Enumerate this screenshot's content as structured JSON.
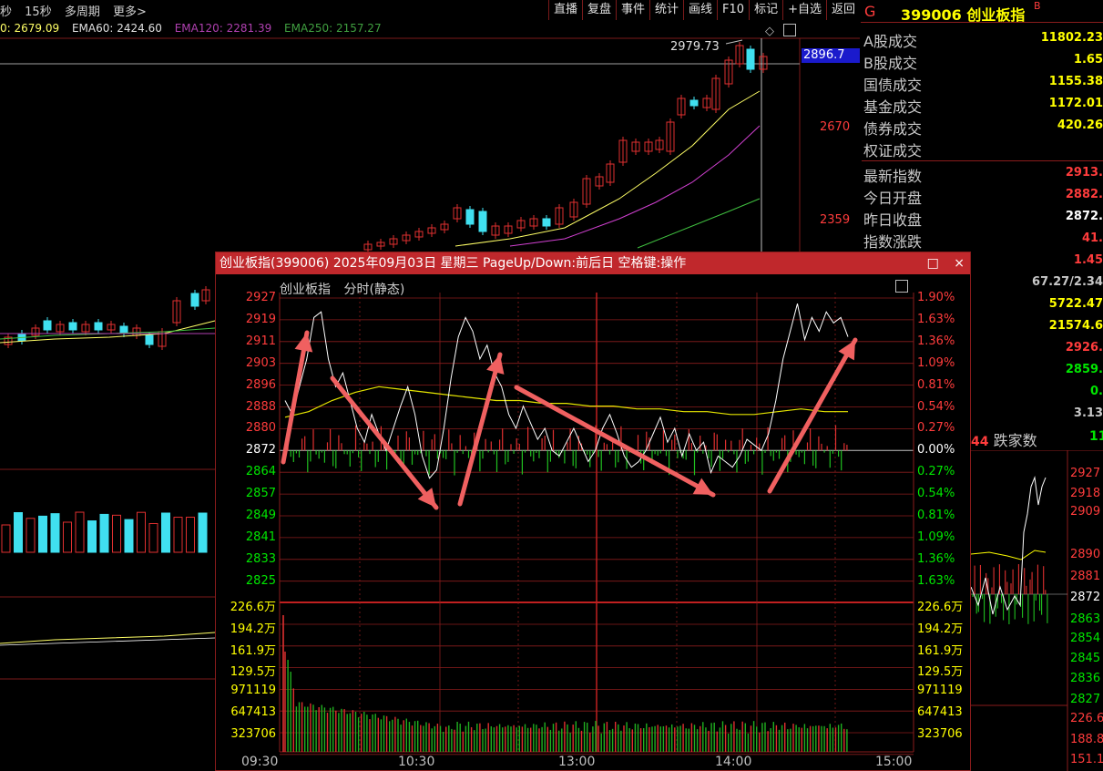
{
  "toolbar": {
    "left_items": [
      "秒",
      "15秒",
      "多周期",
      "更多>"
    ],
    "right_buttons": [
      "直播",
      "复盘",
      "事件",
      "统计",
      "画线",
      "F10",
      "标记",
      "+自选",
      "返回"
    ]
  },
  "ema": {
    "ema_first": "0: 2679.09",
    "ema60": "EMA60: 2424.60",
    "ema120": "EMA120: 2281.39",
    "ema250": "EMA250: 2157.27"
  },
  "main_chart": {
    "high_label": "2979.73",
    "price_box": "2896.7",
    "right_ticks": [
      "2670",
      "2359"
    ]
  },
  "right_panel": {
    "tag": "G",
    "code_name": "399006 创业板指",
    "superscript": "B",
    "rows": [
      {
        "label": "A股成交",
        "value": "11802.23",
        "color": "#ffff00"
      },
      {
        "label": "B股成交",
        "value": "1.65",
        "color": "#ffff00"
      },
      {
        "label": "国债成交",
        "value": "1155.38",
        "color": "#ffff00"
      },
      {
        "label": "基金成交",
        "value": "1172.01",
        "color": "#ffff00"
      },
      {
        "label": "债券成交",
        "value": "420.26",
        "color": "#ffff00"
      },
      {
        "label": "权证成交",
        "value": "",
        "color": "#ffff00"
      },
      {
        "label": "最新指数",
        "value": "2913.",
        "color": "#ff3c3c"
      },
      {
        "label": "今日开盘",
        "value": "2882.",
        "color": "#ff3c3c"
      },
      {
        "label": "昨日收盘",
        "value": "2872.",
        "color": "#ffffff"
      },
      {
        "label": "指数涨跌",
        "value": "41.",
        "color": "#ff3c3c"
      },
      {
        "label": "",
        "value": "1.45",
        "color": "#ff3c3c"
      },
      {
        "label": "",
        "value": "67.27/2.34",
        "color": "#c8c8c8"
      },
      {
        "label": "",
        "value": "5722.47",
        "color": "#ffff00"
      },
      {
        "label": "",
        "value": "21574.6",
        "color": "#ffff00"
      },
      {
        "label": "",
        "value": "2926.",
        "color": "#ff3c3c"
      },
      {
        "label": "",
        "value": "2859.",
        "color": "#00e600"
      },
      {
        "label": "",
        "value": "0.",
        "color": "#00e600"
      },
      {
        "label": "",
        "value": "3.13",
        "color": "#c8c8c8"
      }
    ],
    "decliners_count": "44",
    "decliners_label": "跌家数",
    "decliners_tail": "11",
    "mini_ticks": [
      "2927",
      "2918",
      "2909",
      "2890",
      "2881",
      "2872",
      "2863",
      "2854",
      "2845",
      "2836",
      "2827",
      "226.6",
      "188.8",
      "151.1"
    ]
  },
  "popup": {
    "title": "创业板指(399006) 2025年09月03日 星期三 PageUp/Down:前后日 空格键:操作",
    "maximize_icon": "□",
    "close_icon": "×",
    "subtitle_name": "创业板指",
    "subtitle_mode": "分时(静态)",
    "price_ticks": [
      {
        "v": "2927",
        "pct": "1.90%",
        "c": "#ff3c3c"
      },
      {
        "v": "2919",
        "pct": "1.63%",
        "c": "#ff3c3c"
      },
      {
        "v": "2911",
        "pct": "1.36%",
        "c": "#ff3c3c"
      },
      {
        "v": "2903",
        "pct": "1.09%",
        "c": "#ff3c3c"
      },
      {
        "v": "2896",
        "pct": "0.81%",
        "c": "#ff3c3c"
      },
      {
        "v": "2888",
        "pct": "0.54%",
        "c": "#ff3c3c"
      },
      {
        "v": "2880",
        "pct": "0.27%",
        "c": "#ff3c3c"
      },
      {
        "v": "2872",
        "pct": "0.00%",
        "c": "#ffffff"
      },
      {
        "v": "2864",
        "pct": "0.27%",
        "c": "#00e600"
      },
      {
        "v": "2857",
        "pct": "0.54%",
        "c": "#00e600"
      },
      {
        "v": "2849",
        "pct": "0.81%",
        "c": "#00e600"
      },
      {
        "v": "2841",
        "pct": "1.09%",
        "c": "#00e600"
      },
      {
        "v": "2833",
        "pct": "1.36%",
        "c": "#00e600"
      },
      {
        "v": "2825",
        "pct": "1.63%",
        "c": "#00e600"
      }
    ],
    "volume_ticks": [
      "226.6万",
      "194.2万",
      "161.9万",
      "129.5万",
      "971119",
      "647413",
      "323706"
    ],
    "time_labels": [
      "09:30",
      "10:30",
      "13:00",
      "14:00",
      "15:00"
    ]
  }
}
